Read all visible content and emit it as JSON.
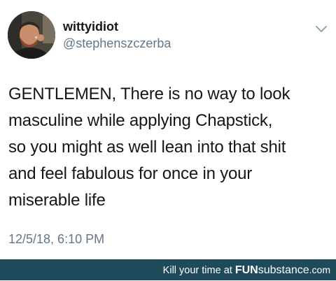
{
  "tweet": {
    "display_name": "wittyidiot",
    "handle": "@stephenszczerba",
    "avatar_icon": "user-avatar-photo",
    "menu_icon": "chevron-down-icon",
    "lines": [
      "GENTLEMEN, There is no way to look",
      "masculine while applying Chapstick,",
      "so you might as well lean into that shit",
      "and feel fabulous for once in your",
      "miserable life"
    ],
    "timestamp": "12/5/18, 6:10 PM"
  },
  "watermark": {
    "prefix": "Kill your time at ",
    "brand_bold": "FUN",
    "brand_rest": "substance",
    "brand_tld": ".com",
    "background_color": "#1e4a5c"
  }
}
